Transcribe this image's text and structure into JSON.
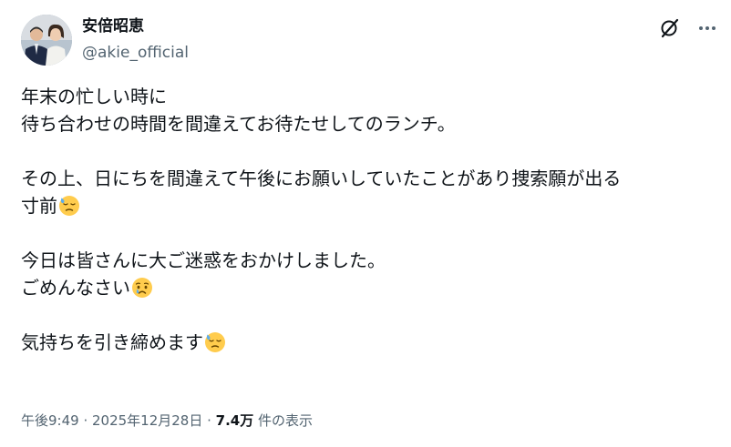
{
  "author": {
    "display_name": "安倍昭恵",
    "handle": "@akie_official"
  },
  "icons": {
    "grok": "grok-icon",
    "more": "more-options-icon"
  },
  "tweet": {
    "lines": [
      "年末の忙しい時に",
      "待ち合わせの時間を間違えてお待たせしてのランチ。",
      "",
      "その上、日にちを間違えて午後にお願いしていたことがあり捜索願が出る",
      "寸前",
      "",
      "今日は皆さんに大ご迷惑をおかけしました。",
      "ごめんなさい",
      "",
      "気持ちを引き締めます"
    ],
    "emoji": {
      "sweat": "downcast-face-with-sweat",
      "crying": "crying-face"
    }
  },
  "meta": {
    "time": "午後9:49",
    "sep1": " · ",
    "date": "2025年12月28日",
    "sep2": " · ",
    "views_count": "7.4万",
    "views_label": " 件の表示"
  },
  "colors": {
    "text": "#0f1419",
    "secondary": "#536471",
    "emoji_face": "#ffcc4d",
    "emoji_sweat": "#5dadec"
  }
}
